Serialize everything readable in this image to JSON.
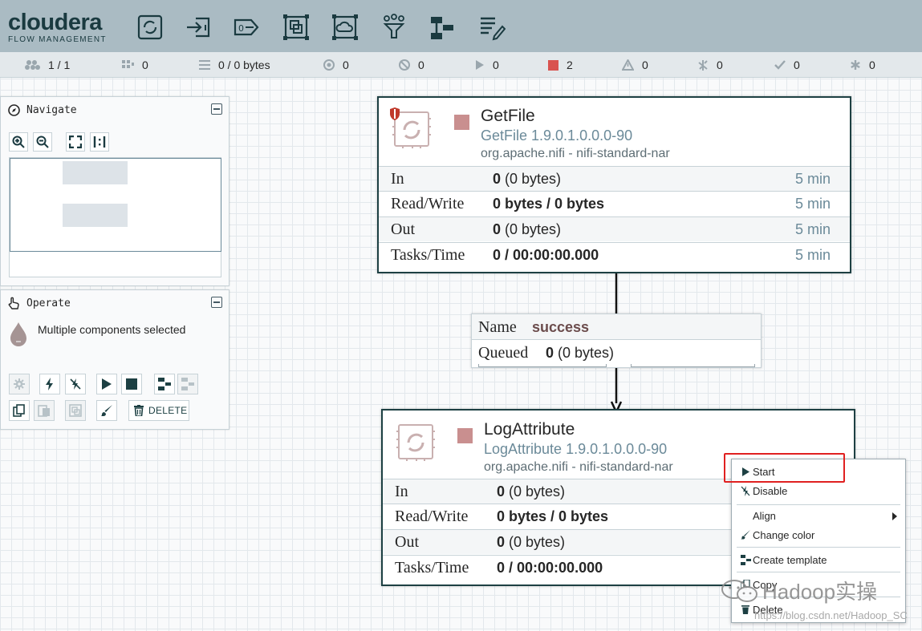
{
  "header": {
    "brand": "cloudera",
    "brand_sub": "FLOW MANAGEMENT",
    "bg_color": "#aabbc3",
    "toolbar_icons": [
      "processor-icon",
      "input-port-icon",
      "output-port-icon",
      "process-group-icon",
      "remote-process-group-icon",
      "funnel-icon",
      "template-icon",
      "label-icon"
    ]
  },
  "status": {
    "cluster": "1 / 1",
    "threads": "0",
    "queued": "0 / 0 bytes",
    "transmitting": "0",
    "not_transmitting": "0",
    "running": "0",
    "stopped": "2",
    "invalid": "0",
    "disabled": "0",
    "up_to_date": "0",
    "locally_modified": "0"
  },
  "navigate": {
    "title": "Navigate"
  },
  "operate": {
    "title": "Operate",
    "selection": "Multiple components selected",
    "delete_label": "DELETE"
  },
  "processors": [
    {
      "name": "GetFile",
      "type": "GetFile 1.9.0.1.0.0.0-90",
      "bundle": "org.apache.nifi - nifi-standard-nar",
      "rows": [
        {
          "label": "In",
          "bold": "0",
          "rest": " (0 bytes)",
          "time": "5 min"
        },
        {
          "label": "Read/Write",
          "bold": "0 bytes / 0 bytes",
          "rest": "",
          "time": "5 min"
        },
        {
          "label": "Out",
          "bold": "0",
          "rest": " (0 bytes)",
          "time": "5 min"
        },
        {
          "label": "Tasks/Time",
          "bold": "0 / 00:00:00.000",
          "rest": "",
          "time": "5 min"
        }
      ]
    },
    {
      "name": "LogAttribute",
      "type": "LogAttribute 1.9.0.1.0.0.0-90",
      "bundle": "org.apache.nifi - nifi-standard-nar",
      "rows": [
        {
          "label": "In",
          "bold": "0",
          "rest": " (0 bytes)",
          "time": ""
        },
        {
          "label": "Read/Write",
          "bold": "0 bytes / 0 bytes",
          "rest": "",
          "time": ""
        },
        {
          "label": "Out",
          "bold": "0",
          "rest": " (0 bytes)",
          "time": ""
        },
        {
          "label": "Tasks/Time",
          "bold": "0 / 00:00:00.000",
          "rest": "",
          "time": ""
        }
      ]
    }
  ],
  "connection": {
    "name_label": "Name",
    "name_value": "success",
    "queued_label": "Queued",
    "queued_bold": "0",
    "queued_rest": " (0 bytes)"
  },
  "context_menu": {
    "items": [
      "Start",
      "Disable",
      "Align",
      "Change color",
      "Create template",
      "Copy",
      "Delete"
    ]
  },
  "watermark": {
    "text": "Hadoop实操",
    "url": "https://blog.csdn.net/Hadoop_SC"
  },
  "colors": {
    "stopped": "#c98f8f",
    "processor_border": "#1d4043",
    "highlight": "#e02020"
  }
}
